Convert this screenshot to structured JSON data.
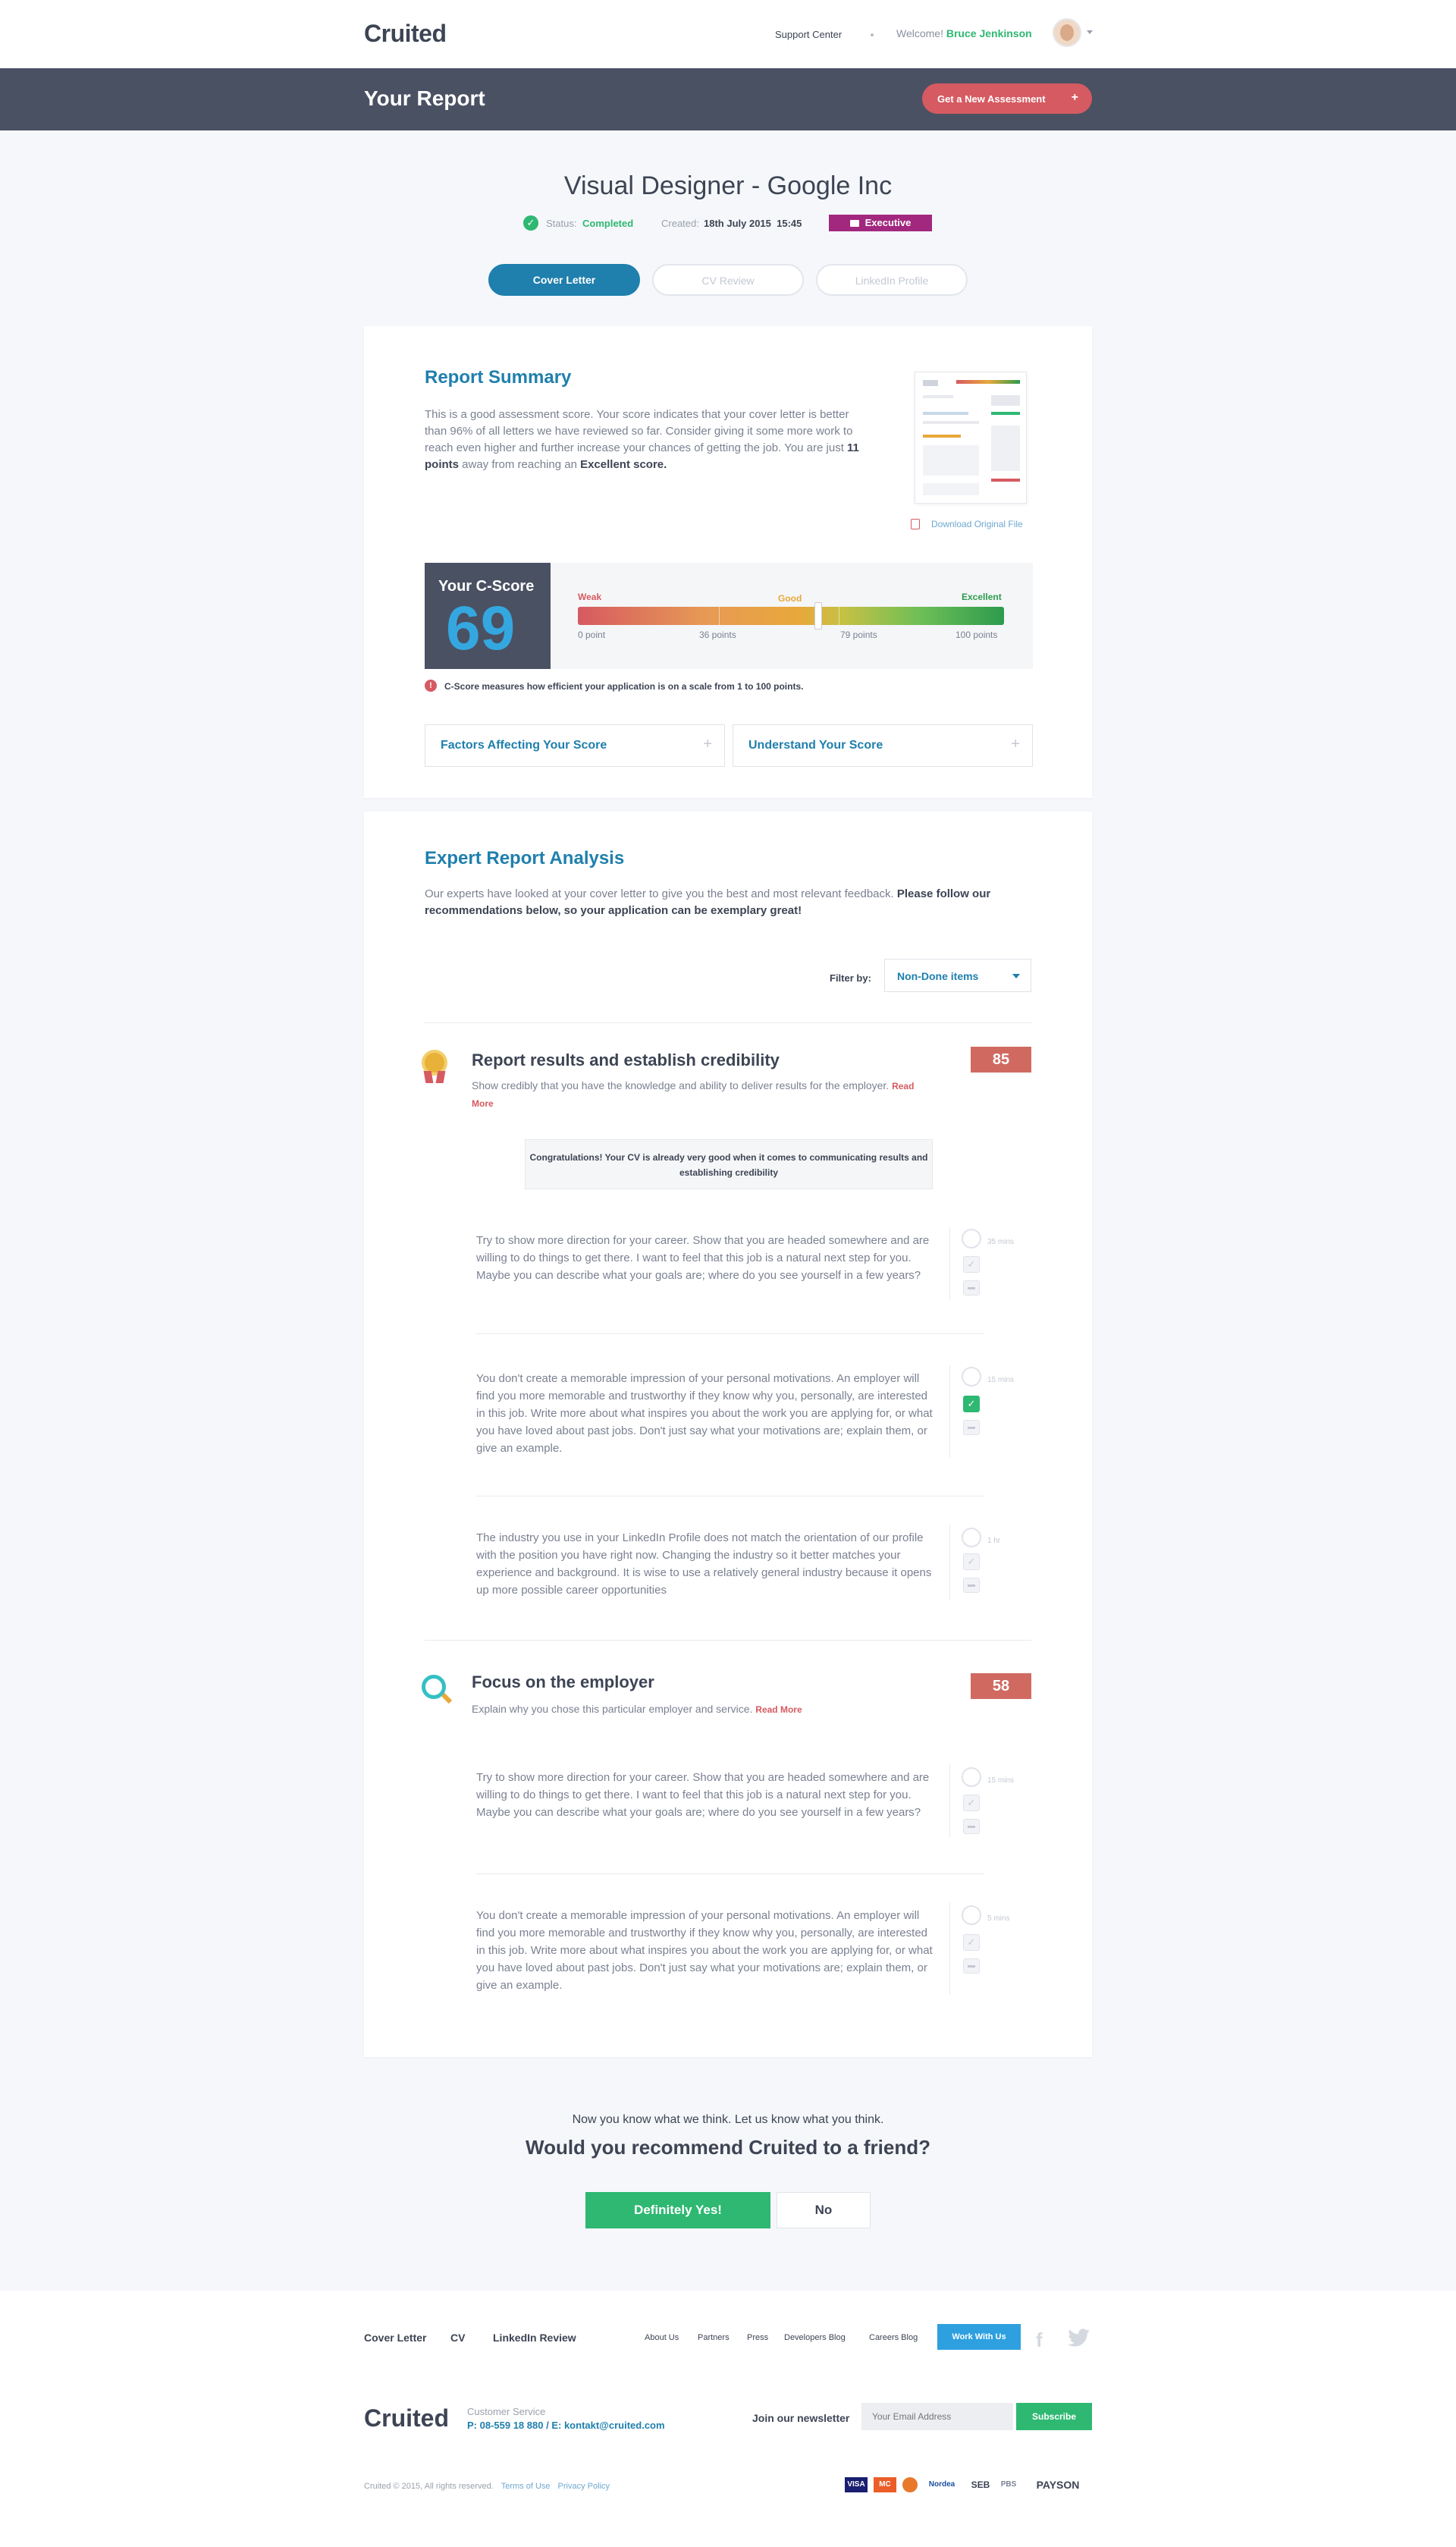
{
  "header": {
    "logo": "Cruited",
    "support_label": "Support Center",
    "welcome_prefix": "Welcome!",
    "user_name": "Bruce Jenkinson"
  },
  "report_bar": {
    "title": "Your Report",
    "new_assessment_label": "Get a New Assessment",
    "new_assessment_icon": "+"
  },
  "job": {
    "title": "Visual Designer - Google Inc",
    "status_label": "Status:",
    "status_value": "Completed",
    "created_label": "Created:",
    "created_value": "18th July 2015  15:45",
    "level_badge": "Executive"
  },
  "tabs": [
    {
      "label": "Cover Letter",
      "active": true
    },
    {
      "label": "CV Review",
      "active": false
    },
    {
      "label": "LinkedIn Profile",
      "active": false
    }
  ],
  "summary": {
    "heading": "Report Summary",
    "text_1": "This is a good assessment score. Your score indicates that your cover letter is better than 96% of all letters we have reviewed so far. Consider giving it some more work to reach even higher and further increase your chances of getting the job. You are just ",
    "points": "11 points",
    "text_2": " away from reaching an ",
    "excellent": "Excellent score.",
    "download_label": "Download Original File",
    "cscore_label": "Your C-Score",
    "cscore_value": "69",
    "cscore_fraction": 0.69,
    "level_weak": "Weak",
    "level_good": "Good",
    "level_excellent": "Excellent",
    "points_labels": [
      "0 point",
      "36 points",
      "79 points",
      "100 points"
    ],
    "info_text": "C-Score measures how efficient your application is on a scale from 1 to 100 points.",
    "accordion": [
      {
        "label": "Factors Affecting Your Score"
      },
      {
        "label": "Understand Your Score"
      }
    ],
    "accent_colors": {
      "weak": "#d65a61",
      "good": "#e8a83a",
      "excellent": "#2d9b4e"
    }
  },
  "analysis": {
    "heading": "Expert Report Analysis",
    "intro": "Our experts have looked at your cover letter to give you the best and most relevant feedback. ",
    "intro_bold": "Please follow our recommendations below, so your application can be exemplary great!",
    "filter_label": "Filter by:",
    "filter_value": "Non-Done items",
    "sections": [
      {
        "title": "Report results and establish credibility",
        "desc": "Show credibly that you have the knowledge and ability to deliver results for the employer.",
        "read_more": "Read More",
        "score": "85",
        "icon": "award-medal-icon",
        "congrats": "Congratulations! Your CV is already very good when it comes to communicating results and establishing credibility",
        "items": [
          {
            "text": "Try to show more direction for your career. Show that you are headed somewhere and are willing to do things to get there. I want to feel that this job is a natural next step for you. Maybe you can describe what your goals are; where do you see yourself in a few years?",
            "time": "35 mins",
            "done": false
          },
          {
            "text": "You don't create a memorable impression of your personal motivations. An employer will find you more memorable and trustworthy if they know why you, personally, are interested in this job. Write more about what inspires you about the work you are applying for, or what you have loved about past jobs. Don't just say what your motivations are; explain them, or give an example.",
            "time": "15 mins",
            "done": true
          },
          {
            "text": "The industry you use in your LinkedIn Profile does not match the orientation of our profile with the position you have right now. Changing the industry so it better matches your experience and background. It is wise to use a relatively general industry because it opens up more possible career opportunities",
            "time": "1 hr",
            "done": false
          }
        ]
      },
      {
        "title": "Focus on the employer",
        "desc": "Explain why you chose this particular employer and service.",
        "read_more": "Read More",
        "score": "58",
        "icon": "magnifier-icon",
        "items": [
          {
            "text": "Try to show more direction for your career. Show that you are headed somewhere and are willing to do things to get there. I want to feel that this job is a natural next step for you. Maybe you can describe what your goals are; where do you see yourself in a few years?",
            "time": "15 mins",
            "done": false
          },
          {
            "text": "You don't create a memorable impression of your personal motivations. An employer will find you more memorable and trustworthy if they know why you, personally, are interested in this job. Write more about what inspires you about the work you are applying for, or what you have loved about past jobs. Don't just say what your motivations are; explain them, or give an example.",
            "time": "5 mins",
            "done": false
          }
        ]
      }
    ]
  },
  "feedback": {
    "subtitle": "Now you know what we think. Let us know what you think.",
    "question": "Would you recommend Cruited to a friend?",
    "yes_label": "Definitely Yes!",
    "no_label": "No"
  },
  "footer": {
    "nav": [
      "Cover Letter",
      "CV",
      "LinkedIn Review"
    ],
    "links": [
      "About Us",
      "Partners",
      "Press",
      "Developers Blog",
      "Careers Blog"
    ],
    "work_label": "Work With Us",
    "social": [
      "facebook-icon",
      "twitter-icon"
    ],
    "logo": "Cruited",
    "cs_label": "Customer Service",
    "phone": "P: 08-559 18 880",
    "sep": "/",
    "email": "E: kontakt@cruited.com",
    "newsletter_label": "Join our newsletter",
    "newsletter_placeholder": "Your Email Address",
    "subscribe_label": "Subscribe",
    "copyright": "Cruited © 2015, All rights reserved.",
    "terms": "Terms of Use",
    "privacy": "Privacy Policy",
    "payments": [
      "VISA",
      "MC",
      "Nordea",
      "SEB",
      "PBS",
      "PAYSON"
    ]
  }
}
